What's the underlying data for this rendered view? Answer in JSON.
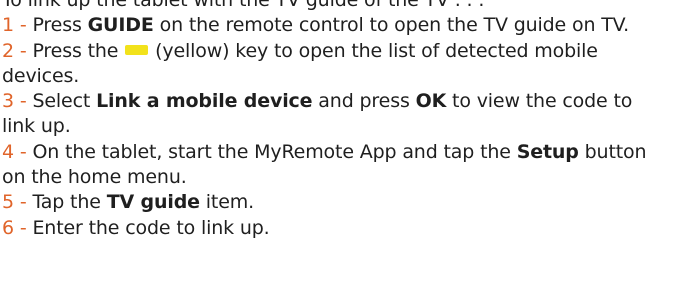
{
  "intro": "To link up the tablet with the TV guide of the TV . . .",
  "steps": [
    {
      "number": "1",
      "parts": [
        "Press ",
        "GUIDE",
        " on the remote control to open the TV guide on TV."
      ]
    },
    {
      "number": "2",
      "parts": [
        "Press the ",
        "(yellow) key to open the list of detected mobile devices."
      ],
      "key_color": "#f2e21b"
    },
    {
      "number": "3",
      "parts": [
        "Select ",
        "Link a mobile device",
        " and press ",
        "OK",
        " to view the code to link up."
      ]
    },
    {
      "number": "4",
      "parts": [
        "On the tablet, start the MyRemote App and tap the ",
        "Setup",
        " button on the home menu."
      ]
    },
    {
      "number": "5",
      "parts": [
        "Tap the ",
        "TV guide",
        " item."
      ]
    },
    {
      "number": "6",
      "parts": [
        "Enter the code to link up."
      ]
    }
  ],
  "separator": " - ",
  "colors": {
    "step_number": "#e0642a",
    "text": "#1f1f1f",
    "yellow_key": "#f2e21b"
  },
  "icons": {
    "yellow_key": "yellow-key-icon"
  }
}
